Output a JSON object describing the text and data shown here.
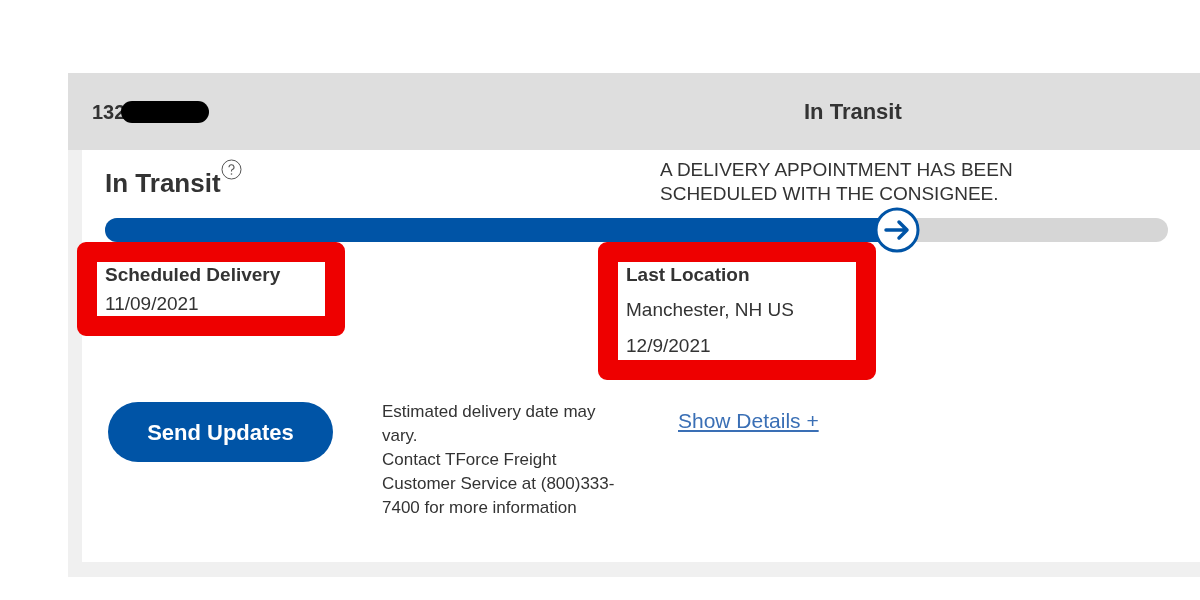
{
  "header": {
    "tracking_number": "132",
    "redacted": true,
    "status": "In Transit"
  },
  "status_title": "In Transit",
  "status_message": "A DELIVERY APPOINTMENT HAS BEEN SCHEDULED WITH THE CONSIGNEE.",
  "progress": {
    "level": 0.745
  },
  "details": [
    {
      "label": "Scheduled Delivery",
      "values": [
        "11/09/2021"
      ],
      "highlighted": true
    },
    {
      "label": "Last Location",
      "values": [
        "Manchester, NH US",
        "12/9/2021"
      ],
      "highlighted": true
    }
  ],
  "send_button": "Send Updates",
  "note_lines": [
    "Estimated delivery date may vary.",
    "Contact TForce Freight Customer Service at (800)333-7400 for more information"
  ],
  "details_link": "Show Details +"
}
